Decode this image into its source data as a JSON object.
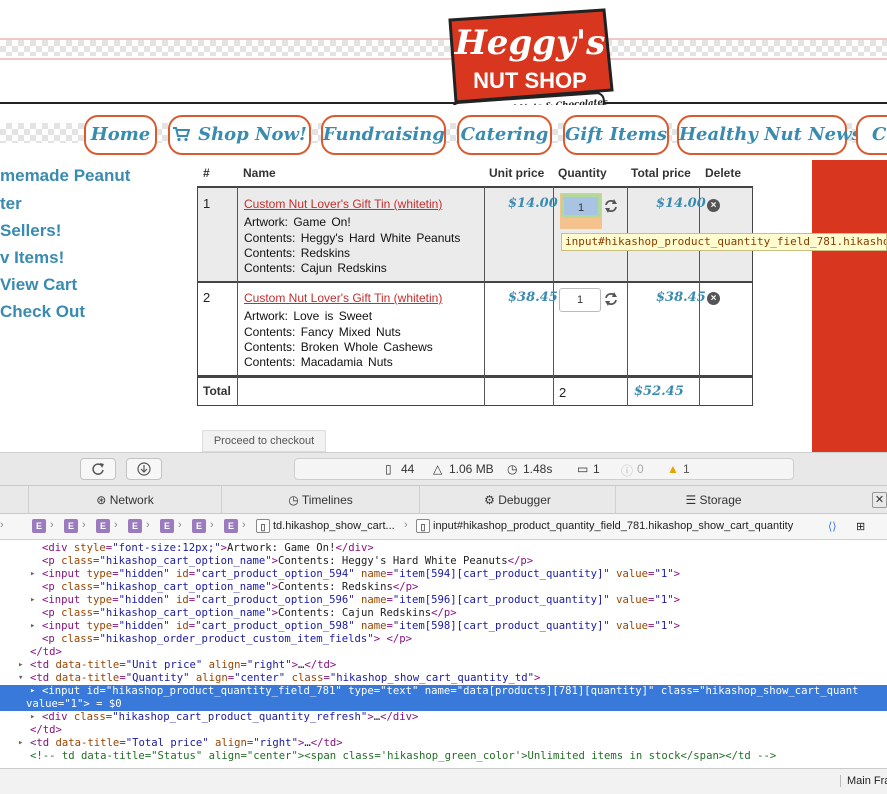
{
  "logo": {
    "line1": "Heggy's",
    "line2": "NUT SHOP",
    "tagline": "Fresh Roasted Nuts & Chocolates"
  },
  "nav": {
    "items": [
      {
        "label": "Home"
      },
      {
        "label": "Shop Now!"
      },
      {
        "label": "Fundraising"
      },
      {
        "label": "Catering"
      },
      {
        "label": "Gift Items"
      },
      {
        "label": "Healthy Nut News"
      },
      {
        "label": "Co"
      }
    ]
  },
  "sidebar": {
    "items": [
      {
        "label": "memade Peanut"
      },
      {
        "label": "ter"
      },
      {
        "label": "Sellers!"
      },
      {
        "label": "v Items!"
      },
      {
        "label": "View Cart"
      },
      {
        "label": "Check Out"
      }
    ]
  },
  "cart": {
    "headers": {
      "num": "#",
      "name": "Name",
      "unit_price": "Unit price",
      "quantity": "Quantity",
      "total_price": "Total price",
      "delete": "Delete"
    },
    "rows": [
      {
        "num": "1",
        "product": "Custom Nut Lover's Gift Tin (whitetin)",
        "options": [
          "Artwork: Game On!",
          "Contents: Heggy's Hard White Peanuts",
          "Contents: Redskins",
          "Contents: Cajun Redskins"
        ],
        "unit_price": "$14.00",
        "quantity": "1",
        "total_price": "$14.00"
      },
      {
        "num": "2",
        "product": "Custom Nut Lover's Gift Tin (whitetin)",
        "options": [
          "Artwork: Love is Sweet",
          "Contents: Fancy Mixed Nuts",
          "Contents: Broken Whole Cashews",
          "Contents: Macadamia Nuts"
        ],
        "unit_price": "$38.45",
        "quantity": "1",
        "total_price": "$38.45"
      }
    ],
    "total": {
      "label": "Total",
      "quantity": "2",
      "price": "$52.45"
    },
    "tooltip": "input#hikashop_product_quantity_field_781.hikasho",
    "checkout_label": "Proceed to checkout"
  },
  "toolbar": {
    "resources": "44",
    "size": "1.06 MB",
    "time": "1.48s",
    "messages": "1",
    "errors": "0",
    "warnings": "1"
  },
  "devtools_tabs": [
    {
      "label": "Network"
    },
    {
      "label": "Timelines"
    },
    {
      "label": "Debugger"
    },
    {
      "label": "Storage"
    }
  ],
  "breadcrumb": {
    "td": "td.hikashop_show_cart...",
    "input": "input#hikashop_product_quantity_field_781.hikashop_show_cart_quantity"
  },
  "dom_lines": [
    {
      "indent": 42,
      "tri": "",
      "html": "<span class='tag'>&lt;div</span> <span class='attr'>style</span>=<span class='val'>\"font-size:12px;\"</span><span class='tag'>&gt;</span><span class='plain'>Artwork: Game On!</span><span class='tag'>&lt;/div&gt;</span>"
    },
    {
      "indent": 42,
      "tri": "",
      "html": "<span class='tag'>&lt;p</span> <span class='attr'>class</span>=<span class='val'>\"hikashop_cart_option_name\"</span><span class='tag'>&gt;</span><span class='plain'>Contents: Heggy's Hard White Peanuts</span><span class='tag'>&lt;/p&gt;</span>"
    },
    {
      "indent": 42,
      "tri": "▸",
      "html": "<span class='tag'>&lt;input</span> <span class='attr'>type</span>=<span class='val'>\"hidden\"</span> <span class='attr'>id</span>=<span class='val'>\"cart_product_option_594\"</span> <span class='attr'>name</span>=<span class='val'>\"item[594][cart_product_quantity]\"</span> <span class='attr'>value</span>=<span class='val'>\"1\"</span><span class='tag'>&gt;</span>"
    },
    {
      "indent": 42,
      "tri": "",
      "html": "<span class='tag'>&lt;p</span> <span class='attr'>class</span>=<span class='val'>\"hikashop_cart_option_name\"</span><span class='tag'>&gt;</span><span class='plain'>Contents: Redskins</span><span class='tag'>&lt;/p&gt;</span>"
    },
    {
      "indent": 42,
      "tri": "▸",
      "html": "<span class='tag'>&lt;input</span> <span class='attr'>type</span>=<span class='val'>\"hidden\"</span> <span class='attr'>id</span>=<span class='val'>\"cart_product_option_596\"</span> <span class='attr'>name</span>=<span class='val'>\"item[596][cart_product_quantity]\"</span> <span class='attr'>value</span>=<span class='val'>\"1\"</span><span class='tag'>&gt;</span>"
    },
    {
      "indent": 42,
      "tri": "",
      "html": "<span class='tag'>&lt;p</span> <span class='attr'>class</span>=<span class='val'>\"hikashop_cart_option_name\"</span><span class='tag'>&gt;</span><span class='plain'>Contents: Cajun Redskins</span><span class='tag'>&lt;/p&gt;</span>"
    },
    {
      "indent": 42,
      "tri": "▸",
      "html": "<span class='tag'>&lt;input</span> <span class='attr'>type</span>=<span class='val'>\"hidden\"</span> <span class='attr'>id</span>=<span class='val'>\"cart_product_option_598\"</span> <span class='attr'>name</span>=<span class='val'>\"item[598][cart_product_quantity]\"</span> <span class='attr'>value</span>=<span class='val'>\"1\"</span><span class='tag'>&gt;</span>"
    },
    {
      "indent": 42,
      "tri": "",
      "html": "<span class='tag'>&lt;p</span> <span class='attr'>class</span>=<span class='val'>\"hikashop_order_product_custom_item_fields\"</span><span class='tag'>&gt;</span> <span class='tag'>&lt;/p&gt;</span>"
    },
    {
      "indent": 30,
      "tri": "",
      "html": "<span class='tag'>&lt;/td&gt;</span>"
    },
    {
      "indent": 30,
      "tri": "▸",
      "html": "<span class='tag'>&lt;td</span> <span class='attr'>data-title</span>=<span class='val'>\"Unit price\"</span> <span class='attr'>align</span>=<span class='val'>\"right\"</span><span class='tag'>&gt;</span><span class='plain'>…</span><span class='tag'>&lt;/td&gt;</span>"
    },
    {
      "indent": 30,
      "tri": "▾",
      "html": "<span class='tag'>&lt;td</span> <span class='attr'>data-title</span>=<span class='val'>\"Quantity\"</span> <span class='attr'>align</span>=<span class='val'>\"center\"</span> <span class='attr'>class</span>=<span class='val'>\"hikashop_show_cart_quantity_td\"</span><span class='tag'>&gt;</span>"
    },
    {
      "indent": 42,
      "tri": "▸",
      "sel": true,
      "html": "<span class='tag'>&lt;input</span> <span class='attr'>id</span>=<span class='val'>\"hikashop_product_quantity_field_781\"</span> <span class='attr'>type</span>=<span class='val'>\"text\"</span> <span class='attr'>name</span>=<span class='val'>\"data[products][781][quantity]\"</span> <span class='attr'>class</span>=<span class='val'>\"hikashop_show_cart_quant</span>"
    },
    {
      "indent": 26,
      "tri": "",
      "sel": true,
      "html": "<span class='val'>value=\"1\"</span><span class='tag'>&gt;</span><span class='plain'> = $0</span>"
    },
    {
      "indent": 42,
      "tri": "▸",
      "html": "<span class='tag'>&lt;div</span> <span class='attr'>class</span>=<span class='val'>\"hikashop_cart_product_quantity_refresh\"</span><span class='tag'>&gt;</span><span class='plain'>…</span><span class='tag'>&lt;/div&gt;</span>"
    },
    {
      "indent": 30,
      "tri": "",
      "html": "<span class='tag'>&lt;/td&gt;</span>"
    },
    {
      "indent": 30,
      "tri": "▸",
      "html": "<span class='tag'>&lt;td</span> <span class='attr'>data-title</span>=<span class='val'>\"Total price\"</span> <span class='attr'>align</span>=<span class='val'>\"right\"</span><span class='tag'>&gt;</span><span class='plain'>…</span><span class='tag'>&lt;/td&gt;</span>"
    },
    {
      "indent": 30,
      "tri": "",
      "html": "<span class='cmt'>&lt;!-- td data-title=\"Status\" align=\"center\"&gt;&lt;span class='hikashop_green_color'&gt;Unlimited items in stock&lt;/span&gt;&lt;/td --&gt;</span>"
    }
  ],
  "bottom": {
    "frame": "Main Fra"
  },
  "colors": {
    "brand_red": "#d8361f",
    "link_blue": "#3a8bb0",
    "selection": "#3879d9"
  }
}
